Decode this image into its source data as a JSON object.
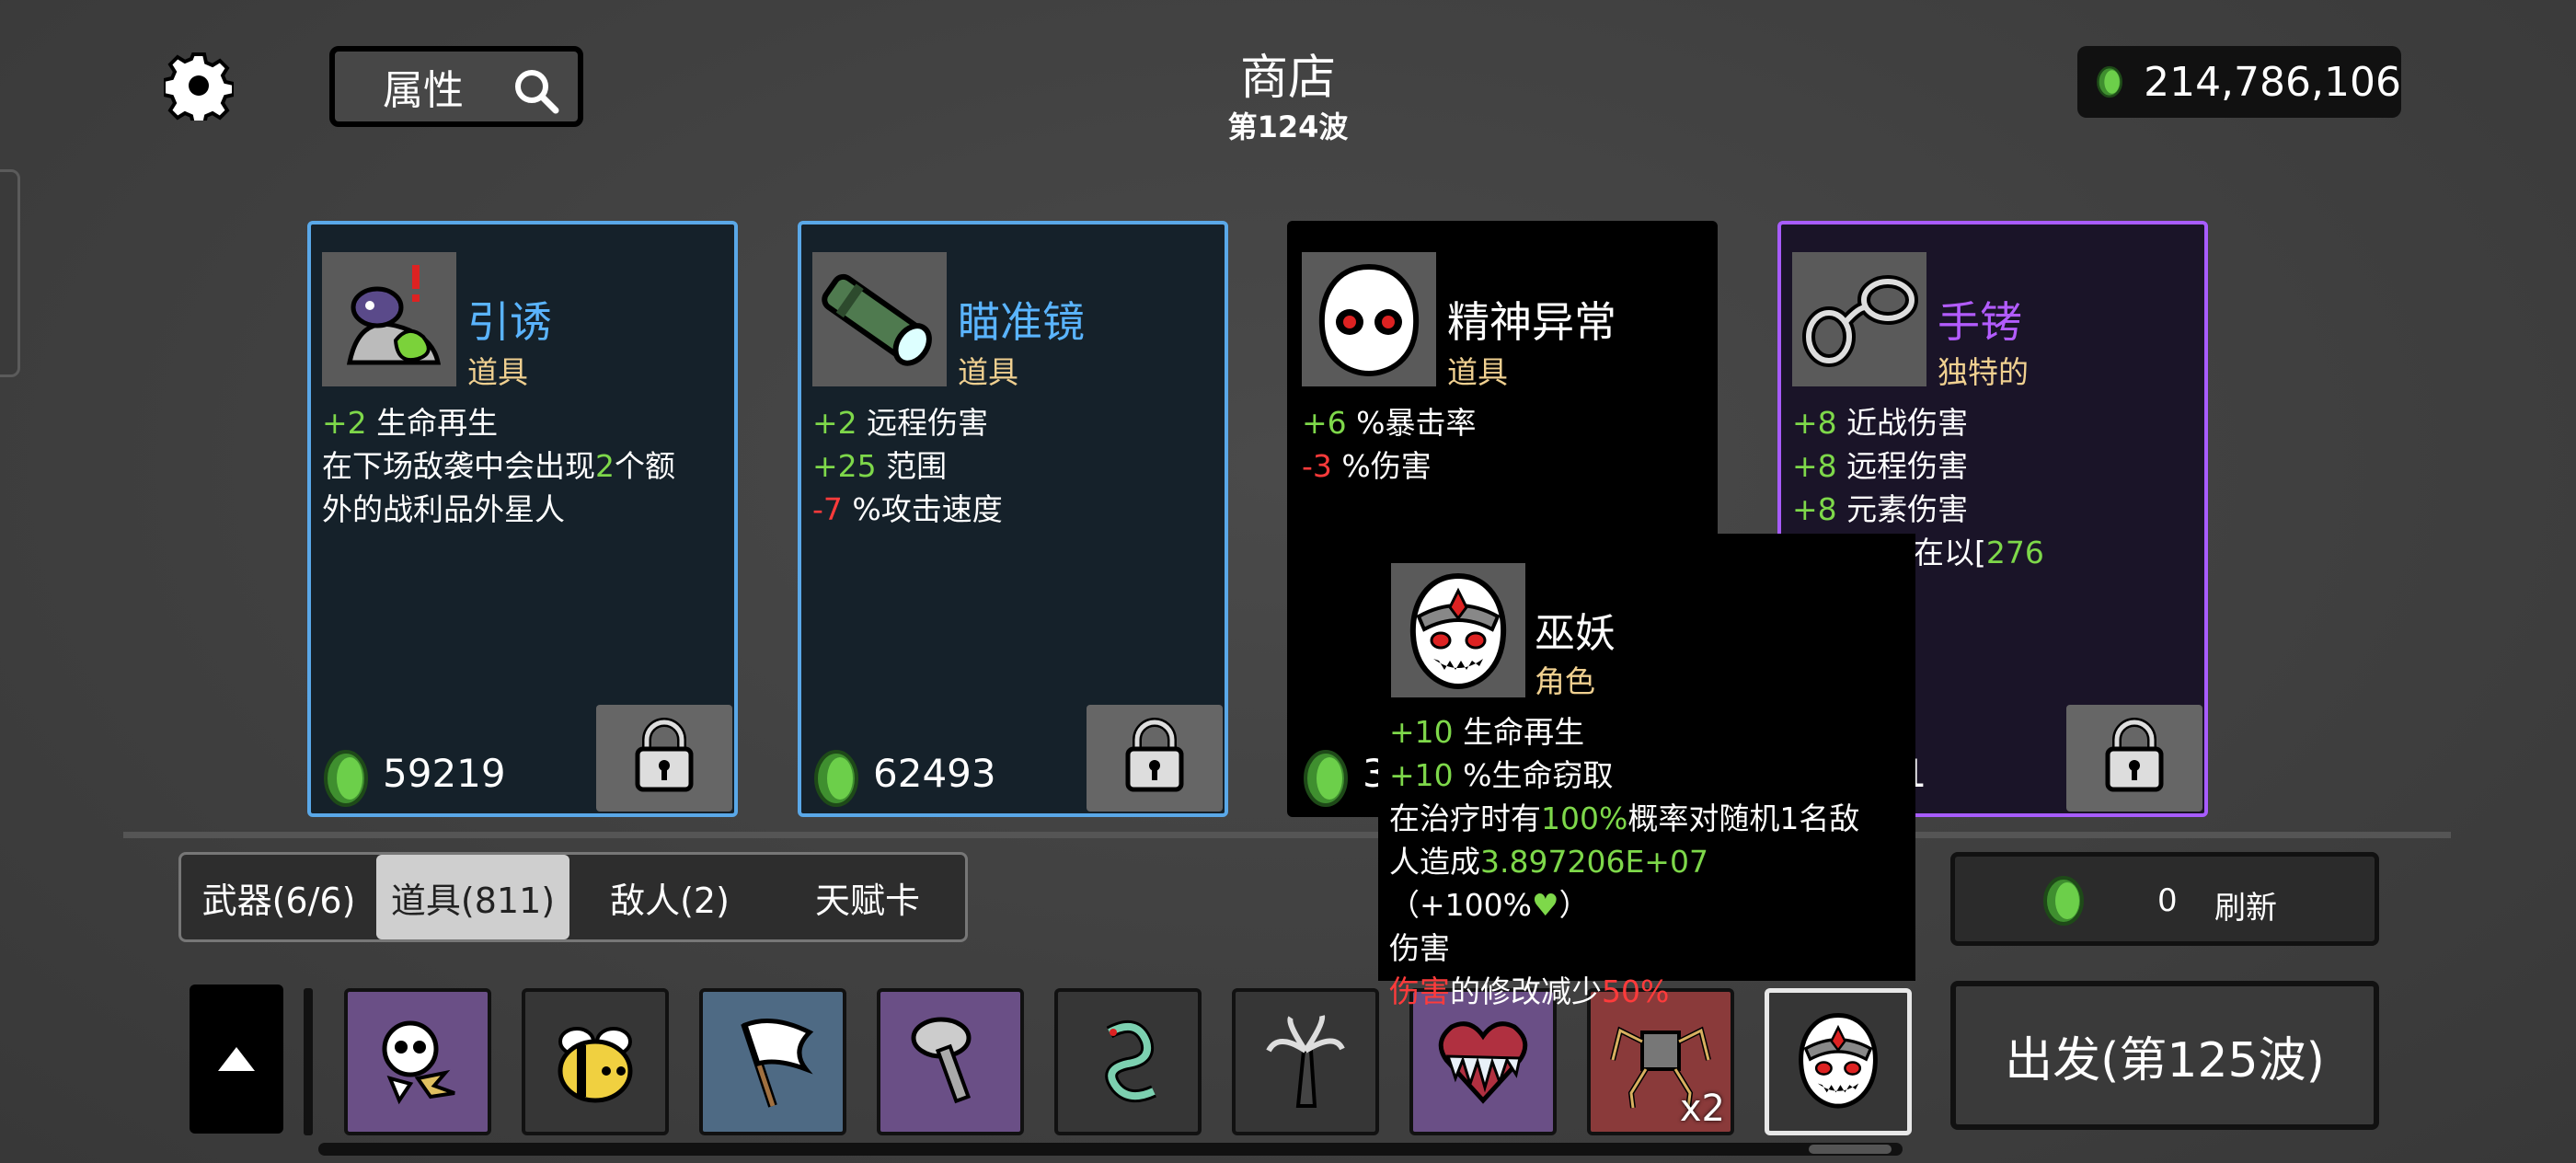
{
  "header": {
    "search_label": "属性",
    "shop_title": "商店",
    "wave_label": "第124波",
    "currency_amount": "214,786,106"
  },
  "cards": [
    {
      "name": "引诱",
      "type": "道具",
      "name_color": "#5ab4ff",
      "border_color": "#5aa8e8",
      "bg": "#15212a",
      "stats": [
        [
          {
            "t": "+2",
            "c": "g"
          },
          {
            "t": " 生命再生"
          }
        ],
        [
          {
            "t": "在下场敌袭中会出现"
          },
          {
            "t": "2",
            "c": "g"
          },
          {
            "t": "个额"
          }
        ],
        [
          {
            "t": "外的战利品外星人"
          }
        ]
      ],
      "price": "59219",
      "icon": "lure-icon"
    },
    {
      "name": "瞄准镜",
      "type": "道具",
      "name_color": "#5ab4ff",
      "border_color": "#5aa8e8",
      "bg": "#15212a",
      "stats": [
        [
          {
            "t": "+2",
            "c": "g"
          },
          {
            "t": " 远程伤害"
          }
        ],
        [
          {
            "t": "+25",
            "c": "g"
          },
          {
            "t": " 范围"
          }
        ],
        [
          {
            "t": "-7",
            "c": "r"
          },
          {
            "t": " %攻击速度"
          }
        ]
      ],
      "price": "62493",
      "icon": "scope-icon"
    },
    {
      "name": "精神异常",
      "type": "道具",
      "name_color": "#ffffff",
      "border_color": "#000000",
      "bg": "#000000",
      "stats": [
        [
          {
            "t": "+6",
            "c": "g"
          },
          {
            "t": " %暴击率"
          }
        ],
        [
          {
            "t": "-3",
            "c": "r"
          },
          {
            "t": " %伤害"
          }
        ]
      ],
      "price": "3",
      "icon": "psychosis-icon"
    },
    {
      "name": "手铐",
      "type": "独特的",
      "name_color": "#b35cff",
      "border_color": "#a85cff",
      "bg": "#1a1428",
      "stats": [
        [
          {
            "t": "+8",
            "c": "g"
          },
          {
            "t": " 近战伤害"
          }
        ],
        [
          {
            "t": "+8",
            "c": "g"
          },
          {
            "t": " 远程伤害"
          }
        ],
        [
          {
            "t": "+8",
            "c": "g"
          },
          {
            "t": " 元素伤害"
          }
        ],
        [
          {
            "t": "生命值现在以["
          },
          {
            "t": "276",
            "c": "g"
          }
        ],
        [
          {
            "t": "上限"
          }
        ]
      ],
      "price": "421",
      "icon": "handcuffs-icon"
    }
  ],
  "tabs": [
    {
      "label": "武器(6/6)",
      "active": false
    },
    {
      "label": "道具(811)",
      "active": true
    },
    {
      "label": "敌人(2)",
      "active": false
    },
    {
      "label": "天赋卡",
      "active": false
    }
  ],
  "refresh": {
    "count": "0",
    "label": "刷新"
  },
  "go_button": "出发(第125波)",
  "inventory": [
    {
      "icon": "skull-splat-icon",
      "bg": "#6a4f86"
    },
    {
      "icon": "bee-icon",
      "bg": "#363636"
    },
    {
      "icon": "white-flag-icon",
      "bg": "#4e6a84"
    },
    {
      "icon": "screw-hammer-icon",
      "bg": "#6a4f86"
    },
    {
      "icon": "alien-worm-icon",
      "bg": "#363636"
    },
    {
      "icon": "claw-tree-icon",
      "bg": "#363636"
    },
    {
      "icon": "frozen-heart-icon",
      "bg": "#6a4f86"
    },
    {
      "icon": "spider-cage-icon",
      "bg": "#8a3a3a",
      "qty": "x2"
    },
    {
      "icon": "lich-icon",
      "bg": "#363636",
      "selected": true
    }
  ],
  "tooltip": {
    "name": "巫妖",
    "type": "角色",
    "stats": [
      [
        {
          "t": "+10",
          "c": "g"
        },
        {
          "t": " 生命再生"
        }
      ],
      [
        {
          "t": "+10",
          "c": "g"
        },
        {
          "t": " %生命窃取"
        }
      ],
      [
        {
          "t": "在治疗时有"
        },
        {
          "t": "100%",
          "c": "g"
        },
        {
          "t": "概率对随机1名敌"
        }
      ],
      [
        {
          "t": "人造成"
        },
        {
          "t": "3.897206E+07",
          "c": "g"
        },
        {
          "t": "（+100%"
        },
        {
          "t": "♥",
          "c": "g"
        },
        {
          "t": "）"
        }
      ],
      [
        {
          "t": "伤害"
        }
      ],
      [
        {
          "t": "伤害",
          "c": "r"
        },
        {
          "t": "的修改减少"
        },
        {
          "t": "50%",
          "c": "r"
        }
      ]
    ]
  },
  "colors": {
    "green": "#7ed84a",
    "red": "#ff3b3b",
    "rarity_blue": "#5aa8e8",
    "rarity_purple": "#a85cff"
  }
}
